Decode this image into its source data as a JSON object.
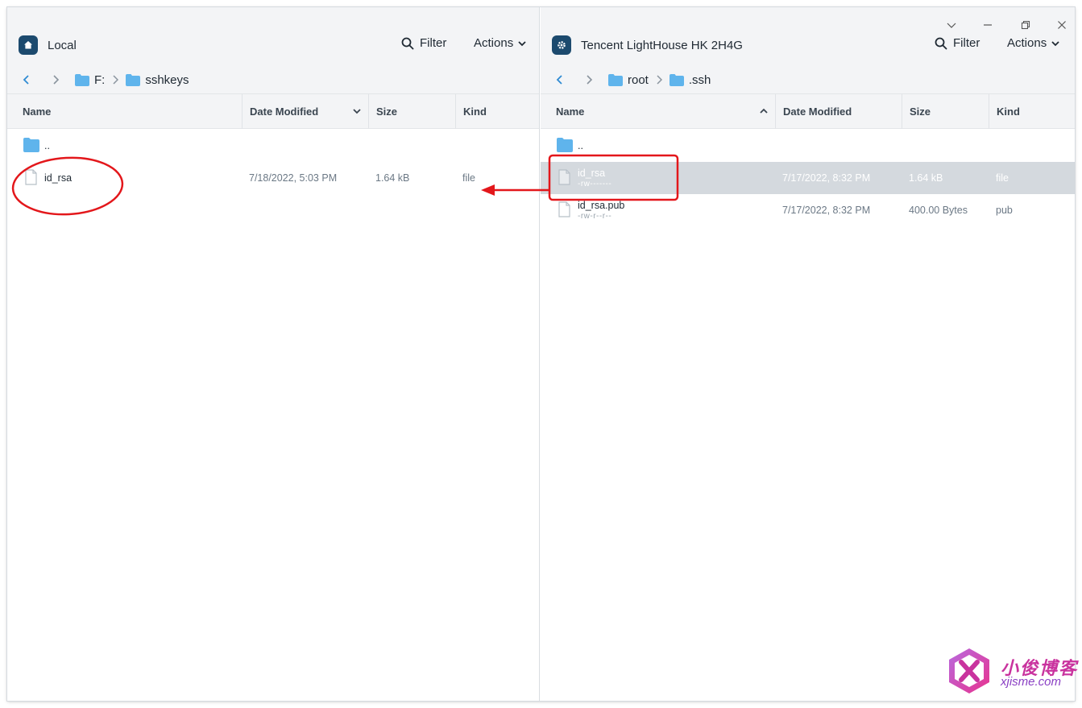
{
  "window": {
    "controls": [
      "chevron-down-icon",
      "minimize-icon",
      "restore-icon",
      "close-icon"
    ]
  },
  "left": {
    "host": "Local",
    "host_icon": "home-icon",
    "filter_label": "Filter",
    "actions_label": "Actions",
    "breadcrumb": [
      "F:",
      "sshkeys"
    ],
    "columns": {
      "name": "Name",
      "date": "Date Modified",
      "size": "Size",
      "kind": "Kind",
      "sorted_by": "Date Modified"
    },
    "rows": [
      {
        "name": "..",
        "type": "folder"
      },
      {
        "name": "id_rsa",
        "date": "7/18/2022, 5:03 PM",
        "size": "1.64 kB",
        "kind": "file",
        "type": "file"
      }
    ]
  },
  "right": {
    "host": "Tencent LightHouse HK 2H4G",
    "host_icon": "gear-icon",
    "filter_label": "Filter",
    "actions_label": "Actions",
    "breadcrumb": [
      "root",
      ".ssh"
    ],
    "columns": {
      "name": "Name",
      "date": "Date Modified",
      "size": "Size",
      "kind": "Kind",
      "sorted_by": "Name"
    },
    "rows": [
      {
        "name": "..",
        "type": "folder"
      },
      {
        "name": "id_rsa",
        "perm": "-rw-------",
        "date": "7/17/2022, 8:32 PM",
        "size": "1.64 kB",
        "kind": "file",
        "type": "file",
        "selected": true
      },
      {
        "name": "id_rsa.pub",
        "perm": "-rw-r--r--",
        "date": "7/17/2022, 8:32 PM",
        "size": "400.00 Bytes",
        "kind": "pub",
        "type": "file"
      }
    ]
  },
  "colors": {
    "accent": "#1c4a6e",
    "folder": "#5fb4ec",
    "selection": "#d4d9de",
    "annotation": "#e3171b",
    "header_bg": "#f3f4f6"
  },
  "watermark": {
    "title": "小俊博客",
    "url": "xjisme.com"
  }
}
